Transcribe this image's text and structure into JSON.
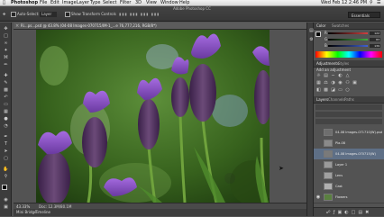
{
  "menubar": {
    "app_name": "Photoshop",
    "items": [
      "File",
      "Edit",
      "Image",
      "Layer",
      "Type",
      "Select",
      "Filter",
      "3D",
      "View",
      "Window",
      "Help"
    ],
    "clock": "Wed Feb 12  2:46 PM"
  },
  "window": {
    "title": "Adobe Photoshop CC"
  },
  "options_bar": {
    "auto_select_label": "Auto-Select:",
    "auto_select_value": "Layer",
    "show_transform_label": "Show Transform Controls",
    "workspace": "Essentials"
  },
  "document": {
    "tab_title": "Ri...ps...psd @ 43.8% (04-08 Images-070715/IM-1_...e 76,777,216, RGB/8*)",
    "zoom": "43.33%",
    "doc_info": "Doc: 12.3M/80.1M"
  },
  "bottom_tabs": [
    "Mini Bridge",
    "Timeline"
  ],
  "panels": {
    "color": {
      "tabs": [
        "Color",
        "Swatches"
      ],
      "sliders": [
        {
          "label": "R",
          "value": "122",
          "color": "#d04040"
        },
        {
          "label": "G",
          "value": "83",
          "color": "#40b040"
        },
        {
          "label": "B",
          "value": "139",
          "color": "#4060d0"
        }
      ]
    },
    "adjustments": {
      "tabs": [
        "Adjustments",
        "Styles"
      ],
      "subtitle": "Add an adjustment"
    },
    "layers": {
      "tabs": [
        "Layers",
        "Channels",
        "Paths"
      ],
      "items": [
        {
          "name": "04-08 Images-071710(W).psd",
          "selected": false,
          "thumb": "#6e6e6e"
        },
        {
          "name": "Pla-08",
          "selected": false,
          "thumb": "#8a8a8a"
        },
        {
          "name": "04-08 Images-070715(W)",
          "selected": true,
          "thumb": "#7a7a7a"
        },
        {
          "name": "Layer 1",
          "selected": false,
          "thumb": "#9a9a9a"
        },
        {
          "name": "Lens",
          "selected": false,
          "thumb": "#a0a0a0"
        },
        {
          "name": "Cast",
          "selected": false,
          "thumb": "#b0b0b0"
        },
        {
          "name": "Flowers",
          "selected": false,
          "thumb": "#5a8040"
        }
      ]
    }
  }
}
